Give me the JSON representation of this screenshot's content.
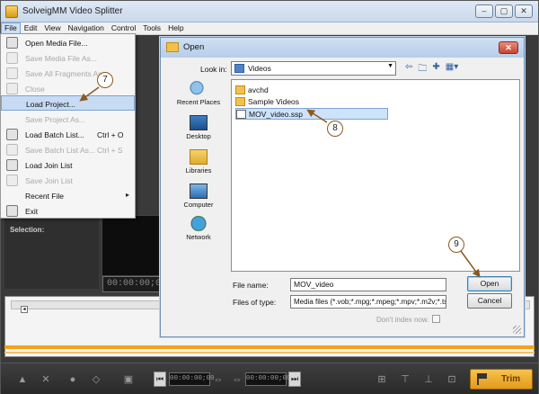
{
  "app": {
    "title": "SolveigMM Video Splitter",
    "window_buttons": [
      "–",
      "▢",
      "✕"
    ]
  },
  "menubar": [
    "File",
    "Edit",
    "View",
    "Navigation",
    "Control",
    "Tools",
    "Help"
  ],
  "file_menu": [
    {
      "label": "Open Media File...",
      "shortcut": "",
      "disabled": false
    },
    {
      "label": "Save Media File As...",
      "shortcut": "",
      "disabled": true
    },
    {
      "label": "Save All Fragments As...",
      "shortcut": "",
      "disabled": true
    },
    {
      "label": "Close",
      "shortcut": "",
      "disabled": true
    },
    {
      "label": "Load Project...",
      "shortcut": "",
      "disabled": false,
      "highlighted": true
    },
    {
      "label": "Save Project As...",
      "shortcut": "",
      "disabled": true
    },
    {
      "label": "Load Batch List...",
      "shortcut": "Ctrl + O",
      "disabled": false
    },
    {
      "label": "Save Batch List As...",
      "shortcut": "Ctrl + S",
      "disabled": true
    },
    {
      "label": "Load Join List",
      "shortcut": "",
      "disabled": false
    },
    {
      "label": "Save Join List",
      "shortcut": "",
      "disabled": true
    },
    {
      "label": "Recent File",
      "shortcut": "",
      "disabled": false,
      "submenu": true
    },
    {
      "label": "Exit",
      "shortcut": "",
      "disabled": false
    }
  ],
  "left_panel": {
    "selection_label": "Selection:"
  },
  "player": {
    "timecode": "00:00:00;00"
  },
  "open_dialog": {
    "title": "Open",
    "look_in_label": "Look in:",
    "look_in_value": "Videos",
    "places": [
      "Recent Places",
      "Desktop",
      "Libraries",
      "Computer",
      "Network"
    ],
    "files": [
      {
        "name": "avchd",
        "type": "folder"
      },
      {
        "name": "Sample Videos",
        "type": "folder"
      },
      {
        "name": "MOV_video.ssp",
        "type": "file",
        "selected": true
      }
    ],
    "file_name_label": "File name:",
    "file_name_value": "MOV_video",
    "files_of_type_label": "Files of type:",
    "files_of_type_value": "Media files (*.vob;*.mpg;*.mpeg;*.mpv;*.m2v;*.ts",
    "open_button": "Open",
    "cancel_button": "Cancel",
    "dont_index_label": "Don't index now."
  },
  "toolbar": {
    "timecode_in": "00:00:00;00",
    "timecode_out": "00:00:00;00",
    "trim_label": "Trim"
  },
  "callouts": [
    "7",
    "8",
    "9"
  ],
  "colors": {
    "accent_orange": "#f3a21a",
    "trim_button": "#e39a1b",
    "selection_blue": "#cde3fa"
  }
}
